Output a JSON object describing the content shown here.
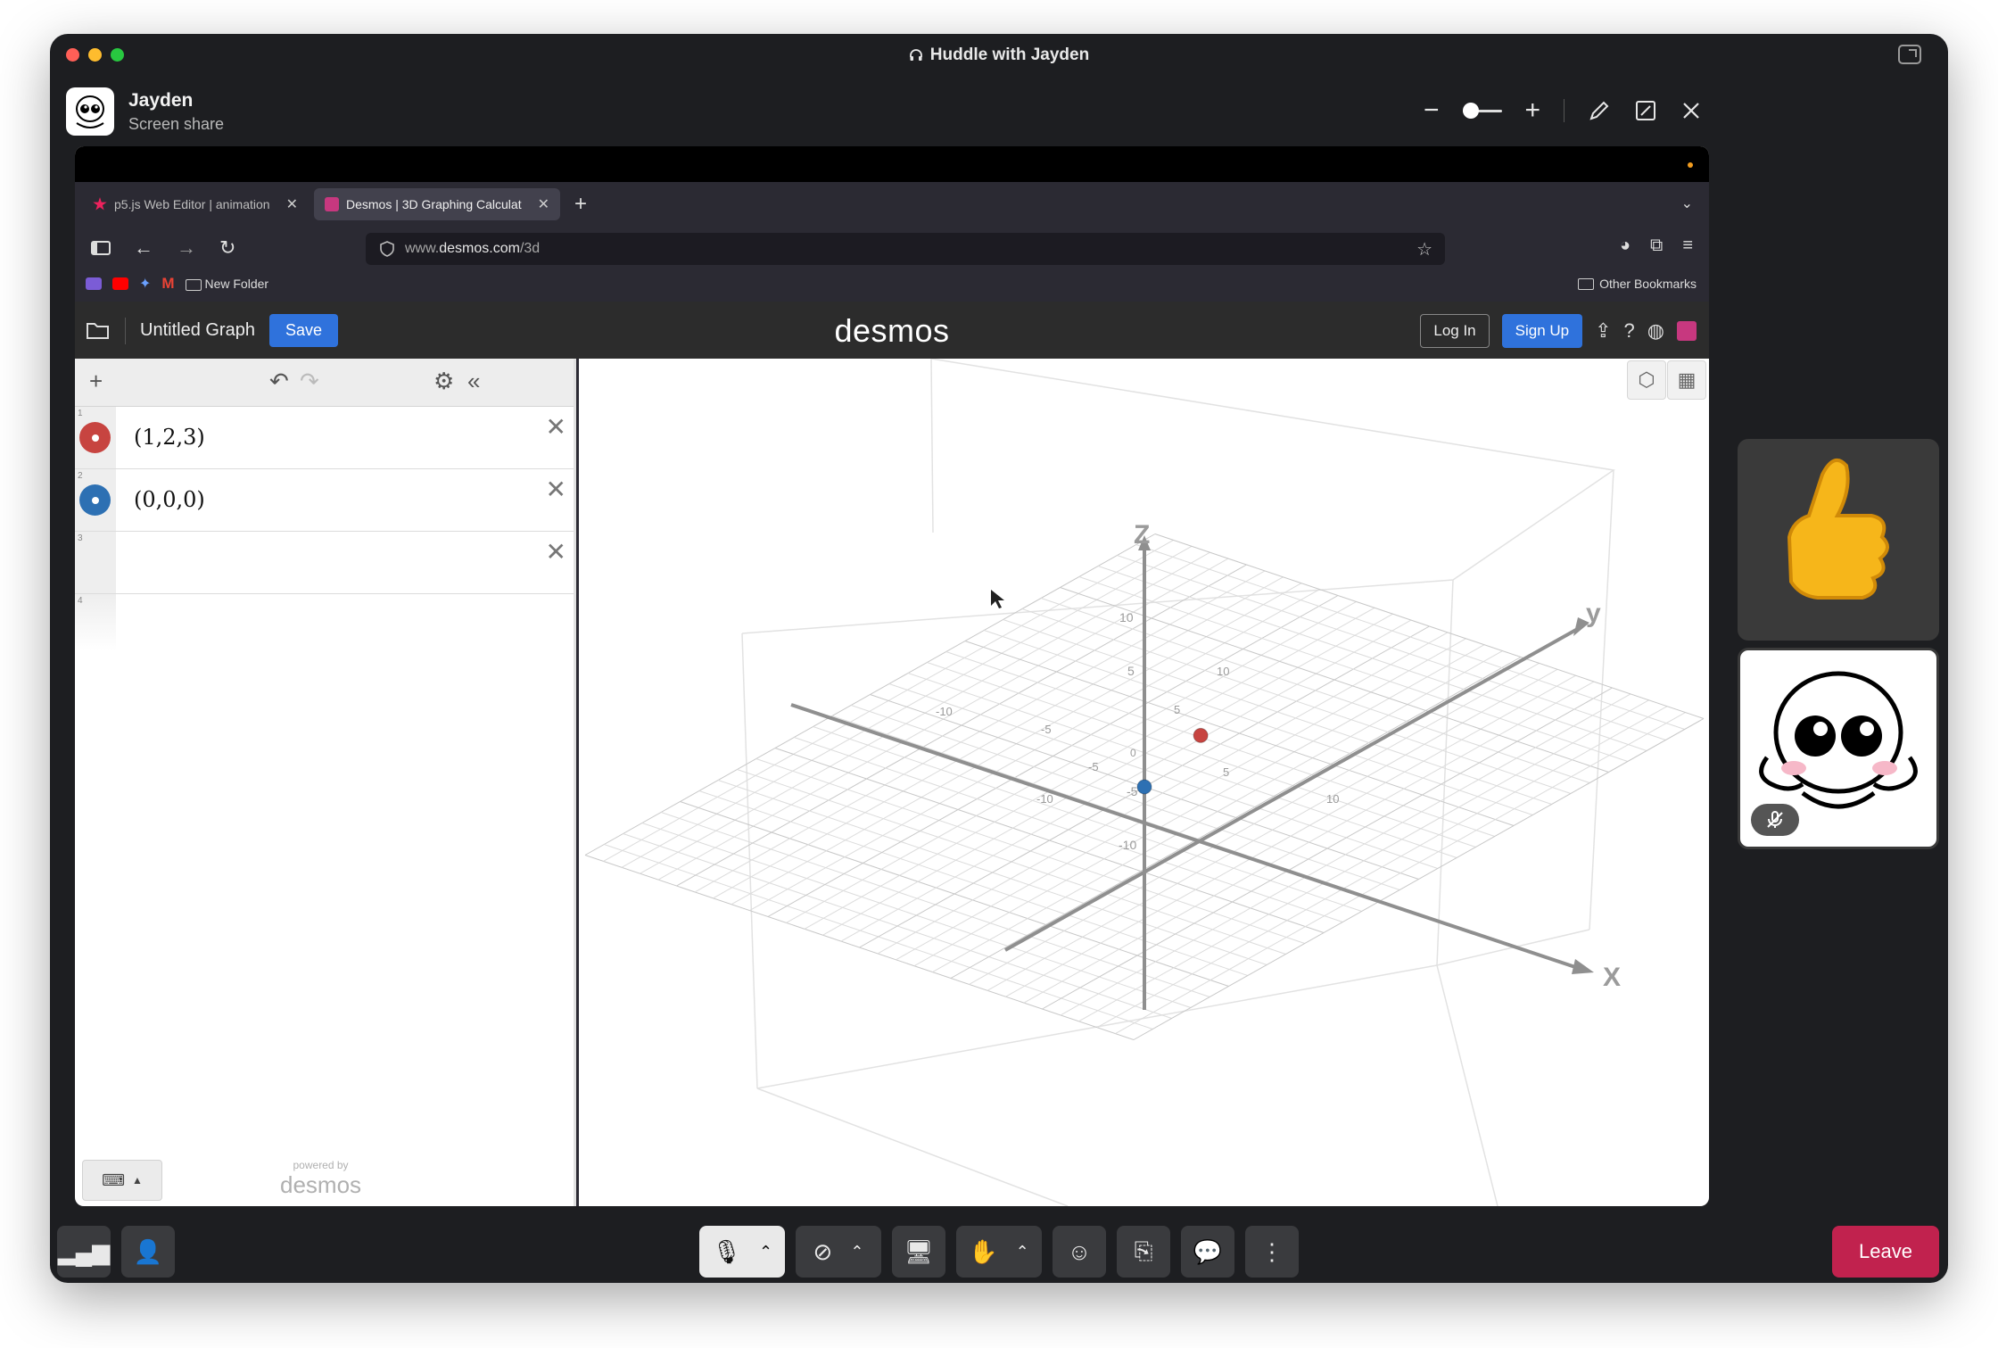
{
  "window": {
    "title": "Huddle with Jayden"
  },
  "share_header": {
    "name": "Jayden",
    "subtitle": "Screen share"
  },
  "browser": {
    "tabs": [
      {
        "label": "p5.js Web Editor | animation",
        "favicon_color": "#ed225d"
      },
      {
        "label": "Desmos | 3D Graphing Calculat",
        "favicon_color": "#c7387f"
      }
    ],
    "url_prefix": "www.",
    "url_domain": "desmos.com",
    "url_path": "/3d",
    "bookmarks": {
      "folder": "New Folder",
      "other": "Other Bookmarks"
    }
  },
  "desmos": {
    "graph_title": "Untitled Graph",
    "save_label": "Save",
    "logo": "desmos",
    "login_label": "Log In",
    "signup_label": "Sign Up",
    "expressions": [
      {
        "num": "1",
        "latex": "(1,2,3)",
        "color": "#c74440"
      },
      {
        "num": "2",
        "latex": "(0,0,0)",
        "color": "#2d70b3"
      },
      {
        "num": "3",
        "latex": ""
      },
      {
        "num": "4",
        "latex": ""
      }
    ],
    "powered_small": "powered by",
    "powered_logo": "desmos",
    "axis_labels": {
      "x": "X",
      "y": "y",
      "z": "Z"
    },
    "ticks": {
      "z": [
        "10",
        "5",
        "-5",
        "-10"
      ],
      "y": [
        "10",
        "5",
        "-5",
        "-10"
      ],
      "x": [
        "-10",
        "-5",
        "5",
        "10"
      ],
      "origin": "0"
    }
  },
  "points_3d": [
    {
      "label": "(1,2,3)",
      "x": 1,
      "y": 2,
      "z": 3,
      "color": "#c74440"
    },
    {
      "label": "(0,0,0)",
      "x": 0,
      "y": 0,
      "z": 0,
      "color": "#2d70b3"
    }
  ],
  "bottom_bar": {
    "leave_label": "Leave"
  }
}
